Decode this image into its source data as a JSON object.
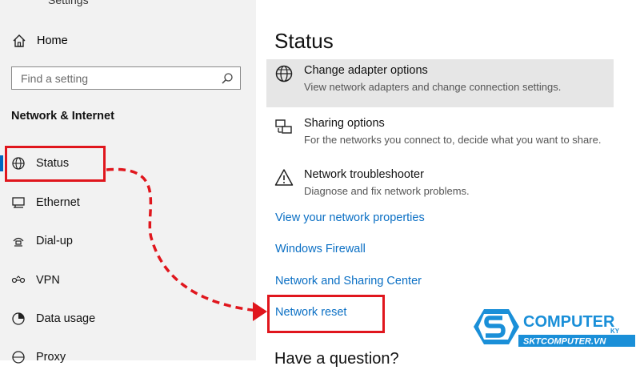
{
  "window": {
    "cut_title": "Settings"
  },
  "sidebar": {
    "home_label": "Home",
    "search_placeholder": "Find a setting",
    "section_label": "Network & Internet",
    "items": [
      {
        "label": "Status",
        "icon": "globe-icon",
        "active": true
      },
      {
        "label": "Ethernet",
        "icon": "ethernet-icon"
      },
      {
        "label": "Dial-up",
        "icon": "dialup-icon"
      },
      {
        "label": "VPN",
        "icon": "vpn-icon"
      },
      {
        "label": "Data usage",
        "icon": "data-usage-icon"
      },
      {
        "label": "Proxy",
        "icon": "proxy-icon"
      }
    ]
  },
  "main": {
    "title": "Status",
    "options": [
      {
        "title": "Change adapter options",
        "desc": "View network adapters and change connection settings.",
        "icon": "globe-icon"
      },
      {
        "title": "Sharing options",
        "desc": "For the networks you connect to, decide what you want to share.",
        "icon": "sharing-icon"
      },
      {
        "title": "Network troubleshooter",
        "desc": "Diagnose and fix network problems.",
        "icon": "warning-icon"
      }
    ],
    "links": [
      "View your network properties",
      "Windows Firewall",
      "Network and Sharing Center",
      "Network reset"
    ],
    "question_heading": "Have a question?"
  },
  "watermark": {
    "line1": "COMPUTER",
    "line2": "SKTCOMPUTER.VN",
    "suffix": "KY"
  },
  "colors": {
    "accent": "#0067c0",
    "link": "#0a6fc4",
    "highlight": "#e0161d",
    "logo_blue": "#1a8fd8"
  }
}
